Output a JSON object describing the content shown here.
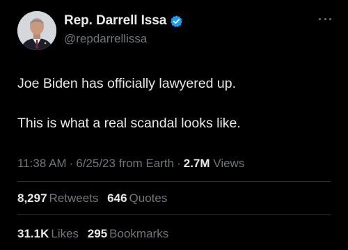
{
  "author": {
    "display_name": "Rep. Darrell Issa",
    "handle": "@repdarrellissa",
    "verified_icon": "verified-badge-icon",
    "verified_color": "#1d9bf0"
  },
  "tweet": {
    "lines": [
      "Joe Biden has officially lawyered up.",
      "This is what a real scandal looks like."
    ],
    "time": "11:38 AM",
    "date": "6/25/23",
    "source": "from Earth",
    "views_count": "2.7M",
    "views_label": "Views"
  },
  "stats": {
    "retweets": {
      "count": "8,297",
      "label": "Retweets"
    },
    "quotes": {
      "count": "646",
      "label": "Quotes"
    },
    "likes": {
      "count": "31.1K",
      "label": "Likes"
    },
    "bookmarks": {
      "count": "295",
      "label": "Bookmarks"
    }
  },
  "colors": {
    "background": "#000000",
    "text": "#e7e9ea",
    "muted": "#71767b",
    "divider": "#2f3336"
  }
}
